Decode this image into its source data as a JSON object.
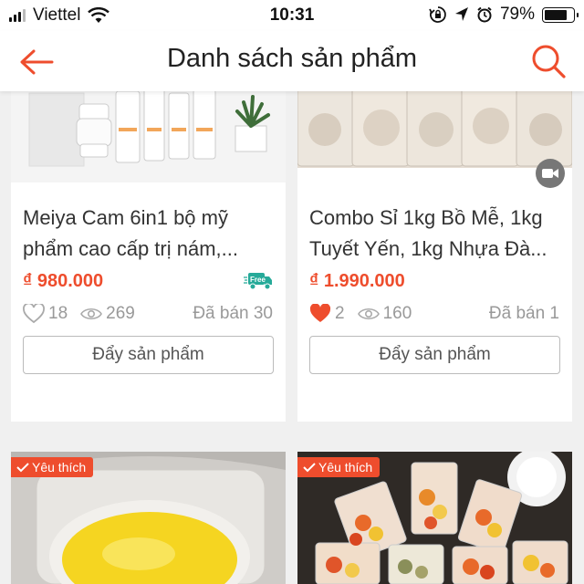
{
  "status_bar": {
    "carrier": "Viettel",
    "time": "10:31",
    "battery": "79%",
    "battery_level": 0.79
  },
  "header": {
    "title": "Danh sách sản phẩm",
    "back_icon": "arrow-left-icon",
    "search_icon": "search-icon"
  },
  "colors": {
    "accent": "#ee4d2d",
    "free_ship": "#26aa99"
  },
  "products": [
    {
      "name": "Meiya Cam 6in1 bộ mỹ phẩm cao cấp trị nám,...",
      "price": "₫ 980.000",
      "likes": "18",
      "views": "269",
      "sold": "Đã bán 30",
      "push_label": "Đẩy sản phẩm",
      "free_ship_label": "Free",
      "liked": false
    },
    {
      "name": "Combo Sỉ 1kg Bồ Mễ, 1kg Tuyết Yến, 1kg Nhựa Đà...",
      "price": "₫ 1.990.000",
      "likes": "2",
      "views": "160",
      "sold": "Đã bán 1",
      "push_label": "Đẩy sản phẩm",
      "liked": true
    },
    {
      "badge": "Yêu thích"
    },
    {
      "badge": "Yêu thích"
    }
  ]
}
